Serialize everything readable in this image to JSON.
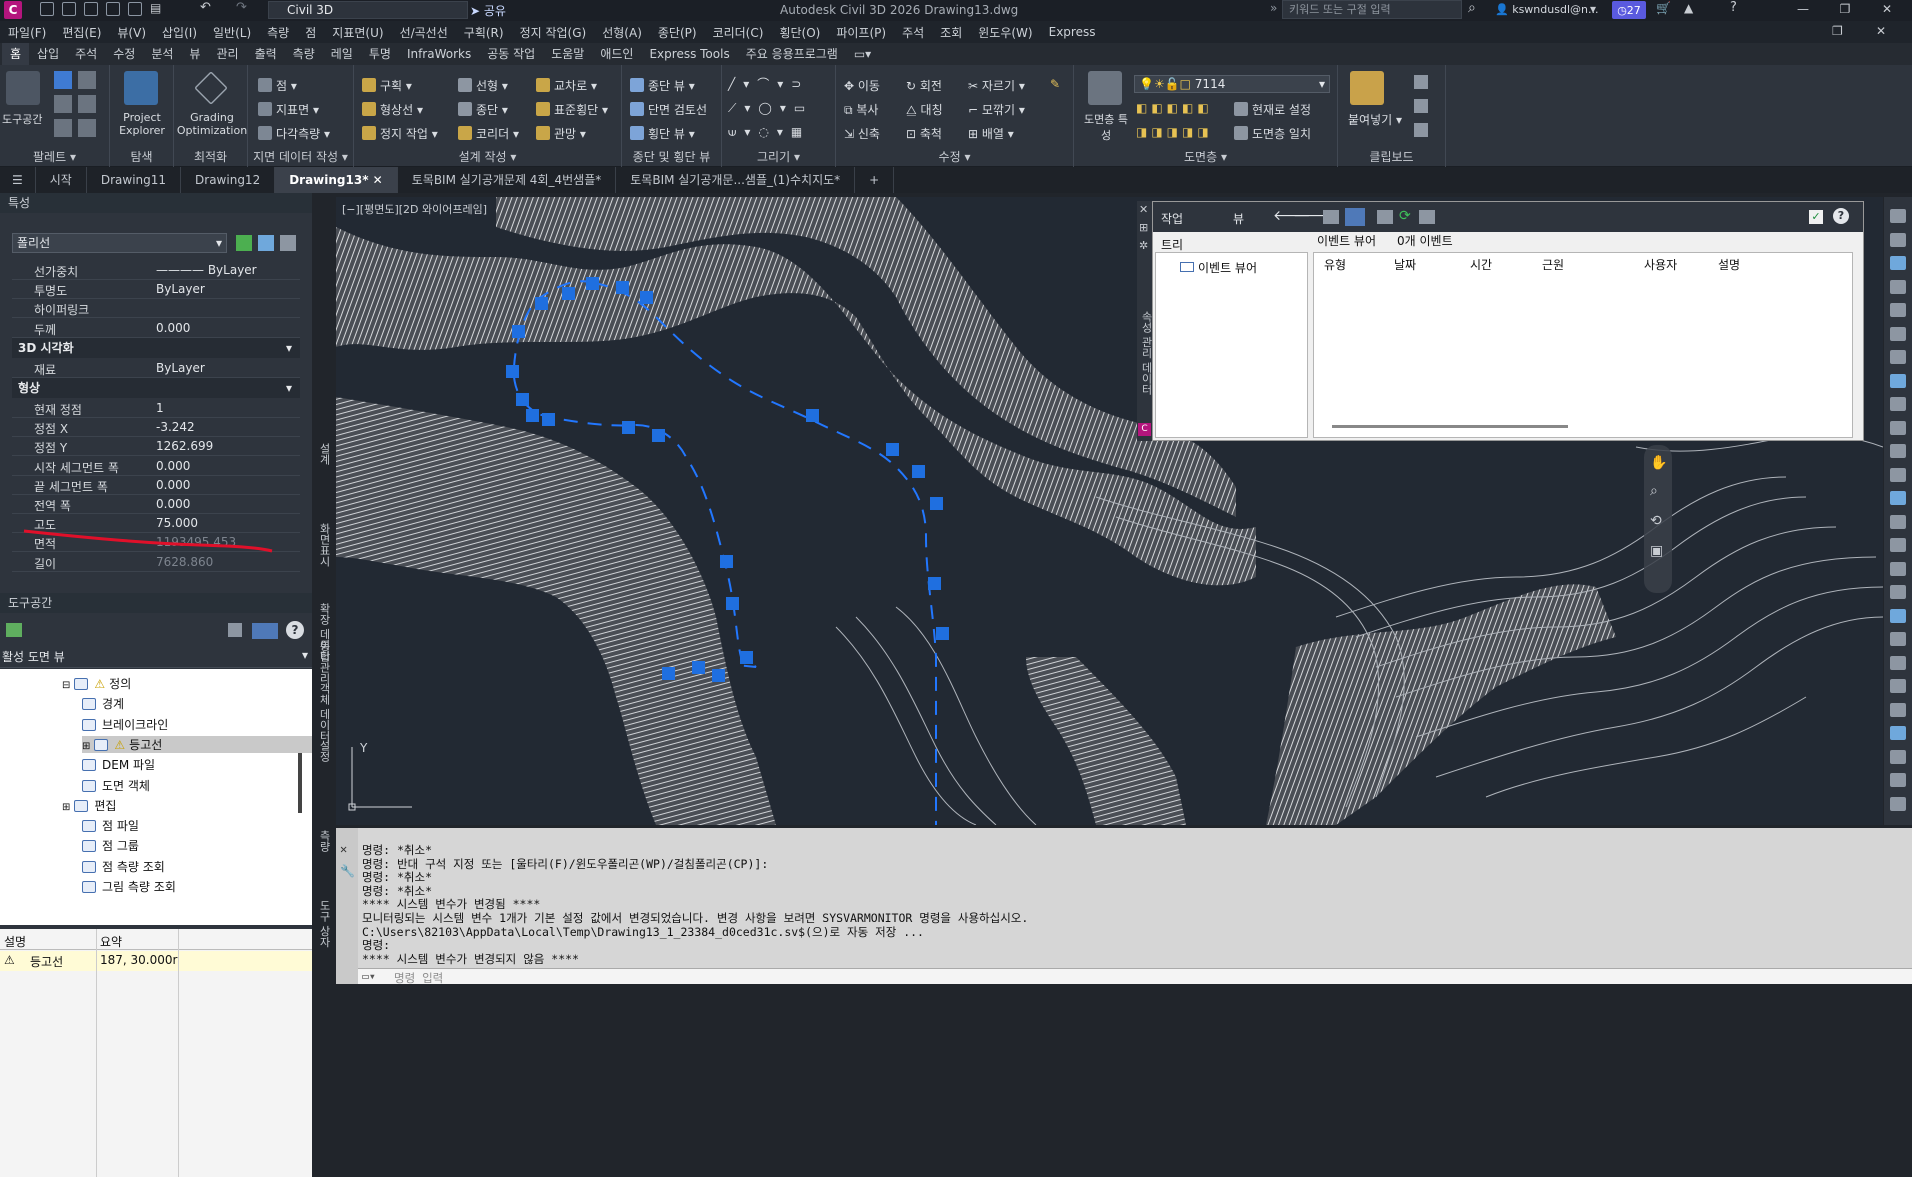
{
  "titlebar": {
    "workspace": "Civil 3D",
    "share": "공유",
    "app_title": "Autodesk Civil 3D 2026    Drawing13.dwg",
    "search_placeholder": "키워드 또는 구절 입력",
    "user": "kswndusdl@n...",
    "notifications": "27"
  },
  "menubar": [
    "파일(F)",
    "편집(E)",
    "뷰(V)",
    "삽입(I)",
    "일반(L)",
    "측량",
    "점",
    "지표면(U)",
    "선/곡선선",
    "구획(R)",
    "정지 작업(G)",
    "선형(A)",
    "종단(P)",
    "코리더(C)",
    "횡단(O)",
    "파이프(P)",
    "주석",
    "조회",
    "윈도우(W)",
    "Express"
  ],
  "ribbon_tabs": [
    "홈",
    "삽입",
    "주석",
    "수정",
    "분석",
    "뷰",
    "관리",
    "출력",
    "측량",
    "레일",
    "투명",
    "InfraWorks",
    "공동 작업",
    "도움말",
    "애드인",
    "Express Tools",
    "주요 응용프로그램"
  ],
  "ribbon": {
    "palettes": {
      "title": "팔레트",
      "toolspace": "도구공간"
    },
    "explore": {
      "title": "탐색",
      "project_explorer": "Project Explorer"
    },
    "optimize": {
      "title": "최적화",
      "grading": "Grading Optimization"
    },
    "ground_data": {
      "title": "지면 데이터 작성",
      "point": "점",
      "surface": "지표면",
      "multi_survey": "다각측량"
    },
    "design": {
      "title": "설계 작성",
      "parcel": "구획",
      "alignment": "선형",
      "intersection": "교차로",
      "feature_line": "형상선",
      "profile": "종단",
      "assembly": "표준횡단",
      "grading": "정지 작업",
      "corridor": "코리더",
      "pipe_network": "관망"
    },
    "profile_section": {
      "title": "종단 및 횡단 뷰",
      "profile_view": "종단 뷰",
      "section_review": "단면 검토선",
      "section_view": "횡단 뷰"
    },
    "draw": {
      "title": "그리기"
    },
    "modify": {
      "title": "수정",
      "move": "이동",
      "rotate": "회전",
      "trim": "자르기",
      "copy": "복사",
      "mirror": "대칭",
      "fillet": "모깎기",
      "stretch": "신축",
      "scale": "축척",
      "array": "배열"
    },
    "layers": {
      "title": "도면층",
      "layer_props": "도면층 특성",
      "layer_name": "7114",
      "set_current": "현재로 설정",
      "match": "도면층 일치"
    },
    "clipboard": {
      "title": "클립보드",
      "paste": "붙여넣기"
    }
  },
  "doc_tabs": [
    "시작",
    "Drawing11",
    "Drawing12",
    "Drawing13*",
    "토목BIM 실기공개문제 4회_4번샘플*",
    "토목BIM 실기공개문...샘플_(1)수치지도*"
  ],
  "properties": {
    "title": "특성",
    "object_type": "폴리선",
    "rows": [
      {
        "k": "선가중치",
        "v": "———— ByLayer"
      },
      {
        "k": "투명도",
        "v": "ByLayer"
      },
      {
        "k": "하이퍼링크",
        "v": ""
      },
      {
        "k": "두께",
        "v": "0.000"
      }
    ],
    "section_3d": "3D 시각화",
    "material": {
      "k": "재료",
      "v": "ByLayer"
    },
    "section_geom": "형상",
    "geom_rows": [
      {
        "k": "현재 정점",
        "v": "1"
      },
      {
        "k": "정점 X",
        "v": "-3.242"
      },
      {
        "k": "정점 Y",
        "v": "1262.699"
      },
      {
        "k": "시작 세그먼트 폭",
        "v": "0.000"
      },
      {
        "k": "끝 세그먼트 폭",
        "v": "0.000"
      },
      {
        "k": "전역 폭",
        "v": "0.000"
      },
      {
        "k": "고도",
        "v": "75.000"
      },
      {
        "k": "면적",
        "v": "1193495.453"
      },
      {
        "k": "길이",
        "v": "7628.860"
      }
    ],
    "side_tabs": [
      "설계",
      "화면표시",
      "확장 데이터",
      "객체 데이터"
    ]
  },
  "toolspace": {
    "title": "도구공간",
    "view": "활성 도면 뷰",
    "tree": [
      {
        "label": "정의",
        "indent": 0
      },
      {
        "label": "경계",
        "indent": 1
      },
      {
        "label": "브레이크라인",
        "indent": 1
      },
      {
        "label": "등고선",
        "indent": 1
      },
      {
        "label": "DEM 파일",
        "indent": 1
      },
      {
        "label": "도면 객체",
        "indent": 1
      },
      {
        "label": "편집",
        "indent": 0
      },
      {
        "label": "점 파일",
        "indent": 1
      },
      {
        "label": "점 그룹",
        "indent": 1
      },
      {
        "label": "점 측량 조회",
        "indent": 1
      },
      {
        "label": "그림 측량 조회",
        "indent": 1
      }
    ],
    "summary_headers": [
      "설명",
      "요약"
    ],
    "summary_row": {
      "name": "등고선",
      "value": "187, 30.000r"
    },
    "side_tabs": [
      "통합관리",
      "설정",
      "측량",
      "도구 상자"
    ]
  },
  "viewport_label": "[−][평면도][2D 와이어프레임]",
  "event_viewer": {
    "tab_task": "작업",
    "tab_view": "뷰",
    "tree_label": "트리",
    "tree_node": "이벤트 뷰어",
    "panel_title": "이벤트 뷰어",
    "event_count": "0개 이벤트",
    "columns": [
      "유형",
      "날짜",
      "시간",
      "근원",
      "사용자",
      "설명"
    ],
    "side_label": "속성 관리 데이터"
  },
  "command_history": [
    "명령: *취소*",
    "명령: 반대 구석 지정 또는 [울타리(F)/윈도우폴리곤(WP)/걸침폴리곤(CP)]:",
    "명령: *취소*",
    "명령: *취소*",
    "**** 시스템 변수가 변경됨 ****",
    "모니터링되는 시스템 변수 1개가 기본 설정 값에서 변경되었습니다. 변경 사항을 보려면 SYSVARMONITOR 명령을 사용하십시오.",
    "C:\\Users\\82103\\AppData\\Local\\Temp\\Drawing13_1_23384_d0ced31c.sv$(으)로 자동 저장 ...",
    "명령:",
    "**** 시스템 변수가 변경되지 않음 ****"
  ],
  "command_input_placeholder": "명령 입력",
  "colors": {
    "accent": "#1a73e8",
    "polyline": "#1f6fe0",
    "dark_bg": "#222933",
    "annotation": "#e0102a"
  }
}
